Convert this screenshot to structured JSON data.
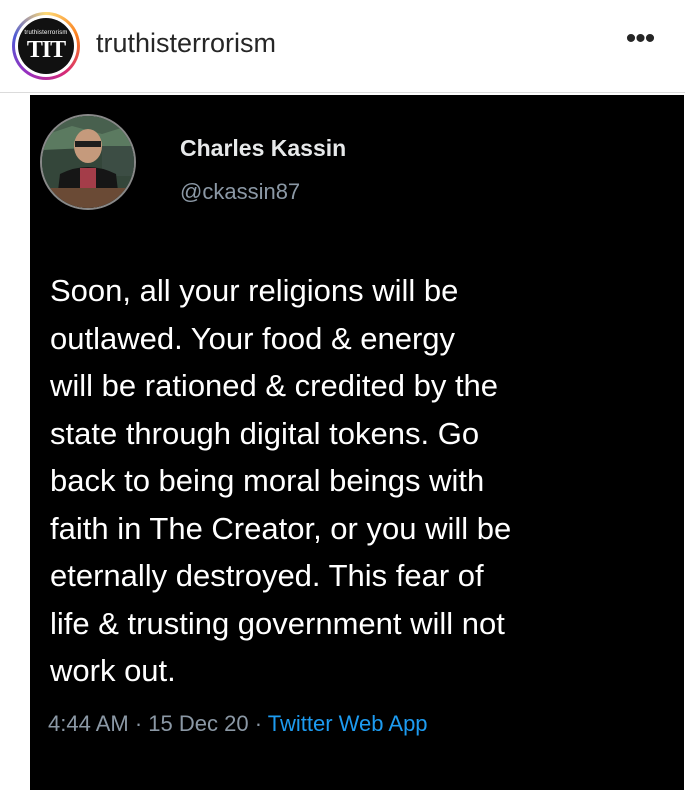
{
  "instagram": {
    "username": "truthisterrorism",
    "avatar_text_small": "truthisterrorism",
    "avatar_text_big": "TIT",
    "more_icon": "more-dots-icon",
    "ring_colors": [
      "#feda75",
      "#fa7e1e",
      "#d62976",
      "#962fbf",
      "#4f5bd5"
    ]
  },
  "tweet": {
    "display_name": "Charles Kassin",
    "handle": "@ckassin87",
    "text": "Soon, all your religions will be\noutlawed. Your food & energy\nwill be rationed & credited by the\nstate through digital tokens. Go\nback to being moral beings with\nfaith in The Creator, or you will be\neternally destroyed. This fear of\nlife & trusting government will not\nwork out.",
    "time": "4:44 AM",
    "date": "15 Dec 20",
    "separator": "·",
    "source": "Twitter Web App",
    "colors": {
      "background": "#000000",
      "text": "#ffffff",
      "muted": "#8b98a5",
      "link": "#1d9bf0"
    }
  }
}
